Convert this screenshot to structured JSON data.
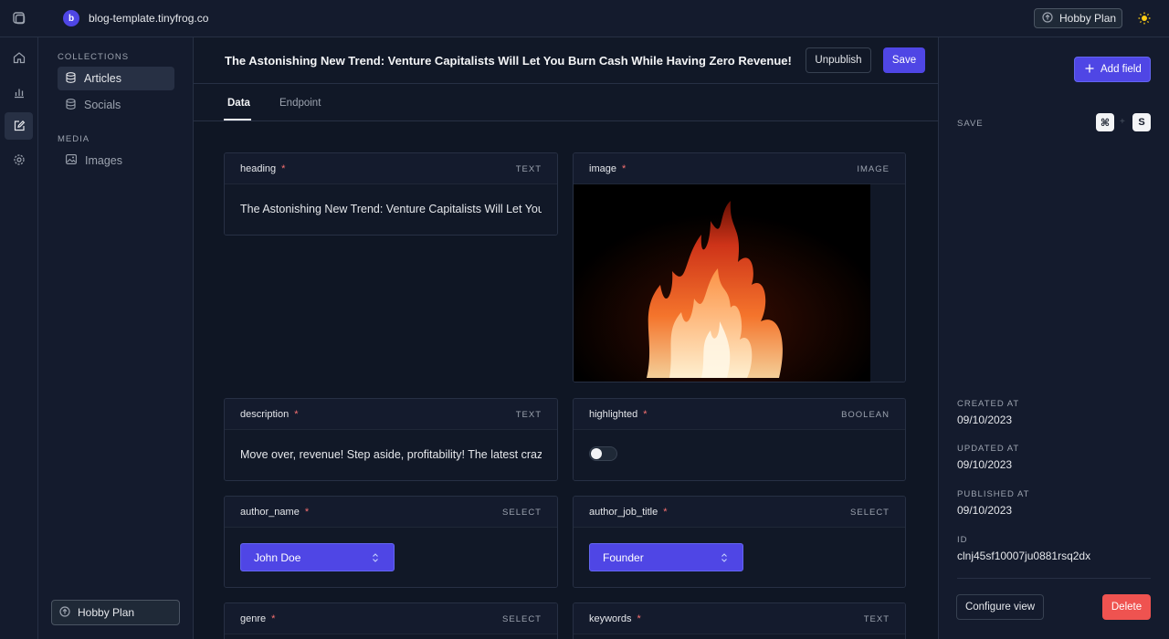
{
  "topbar": {
    "workspace_initial": "b",
    "workspace_name": "blog-template.tinyfrog.co",
    "plan_label": "Hobby Plan"
  },
  "sidebar": {
    "collections_heading": "COLLECTIONS",
    "collections": [
      {
        "label": "Articles",
        "icon": "database-icon",
        "active": true
      },
      {
        "label": "Socials",
        "icon": "database-icon",
        "active": false
      }
    ],
    "media_heading": "MEDIA",
    "media": [
      {
        "label": "Images",
        "icon": "image-icon"
      }
    ],
    "plan_label": "Hobby Plan"
  },
  "document": {
    "title": "The Astonishing New Trend: Venture Capitalists Will Let You Burn Cash While Having Zero Revenue!",
    "unpublish_label": "Unpublish",
    "save_label": "Save",
    "tabs": [
      {
        "label": "Data",
        "active": true
      },
      {
        "label": "Endpoint",
        "active": false
      }
    ]
  },
  "fields": {
    "heading": {
      "name": "heading",
      "type": "TEXT",
      "value": "The Astonishing New Trend: Venture Capitalists Will Let You Burn Cash While Having Zero Revenue!"
    },
    "image": {
      "name": "image",
      "type": "IMAGE"
    },
    "description": {
      "name": "description",
      "type": "TEXT",
      "value": "Move over, revenue! Step aside, profitability! The latest craze"
    },
    "highlighted": {
      "name": "highlighted",
      "type": "BOOLEAN",
      "value": false
    },
    "author_name": {
      "name": "author_name",
      "type": "SELECT",
      "value": "John Doe"
    },
    "author_job_title": {
      "name": "author_job_title",
      "type": "SELECT",
      "value": "Founder"
    },
    "genre": {
      "name": "genre",
      "type": "SELECT"
    },
    "keywords": {
      "name": "keywords",
      "type": "TEXT"
    },
    "required_marker": "*"
  },
  "panel": {
    "add_field_label": "Add field",
    "save_label": "SAVE",
    "shortcut_keys": [
      "⌘",
      "S"
    ],
    "shortcut_plus": "+",
    "created_at_label": "CREATED AT",
    "created_at": "09/10/2023",
    "updated_at_label": "UPDATED AT",
    "updated_at": "09/10/2023",
    "published_at_label": "PUBLISHED AT",
    "published_at": "09/10/2023",
    "id_label": "ID",
    "id": "clnj45sf10007ju0881rsq2dx",
    "configure_view_label": "Configure view",
    "delete_label": "Delete"
  },
  "colors": {
    "accent": "#4f46e5",
    "danger": "#ef5350",
    "background": "#111827",
    "surface": "#141b2d"
  }
}
